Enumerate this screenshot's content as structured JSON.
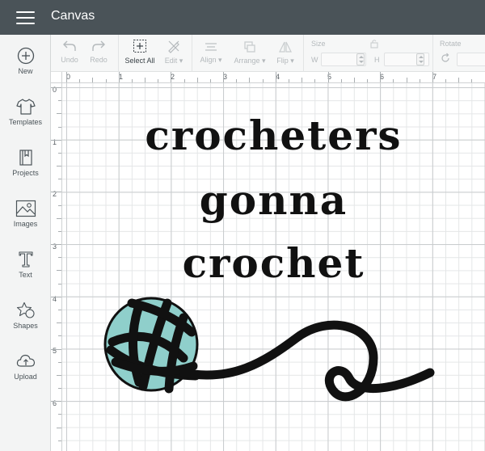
{
  "app": {
    "title": "Canvas"
  },
  "sidebar": {
    "items": [
      {
        "label": "New",
        "icon": "plus-circle-icon"
      },
      {
        "label": "Templates",
        "icon": "tshirt-icon"
      },
      {
        "label": "Projects",
        "icon": "book-icon"
      },
      {
        "label": "Images",
        "icon": "image-icon"
      },
      {
        "label": "Text",
        "icon": "text-t-icon"
      },
      {
        "label": "Shapes",
        "icon": "shapes-icon"
      },
      {
        "label": "Upload",
        "icon": "cloud-upload-icon"
      }
    ]
  },
  "toolbar": {
    "undo": "Undo",
    "redo": "Redo",
    "select_all": "Select All",
    "edit": "Edit",
    "align": "Align",
    "arrange": "Arrange",
    "flip": "Flip",
    "size": "Size",
    "w": "W",
    "h": "H",
    "rotate": "Rotate"
  },
  "ruler": {
    "top": [
      "0",
      "1",
      "2",
      "3",
      "4",
      "5",
      "6",
      "7"
    ],
    "left": [
      "0",
      "1",
      "2",
      "3",
      "4",
      "5",
      "6"
    ]
  },
  "design": {
    "lines": [
      "crocheters",
      "gonna",
      "crochet"
    ],
    "yarn_color": "#8fcfcb",
    "ink_color": "#111111"
  },
  "colors": {
    "titlebar": "#4a5358",
    "sidebar": "#f3f4f4",
    "toolbar": "#f6f7f7"
  }
}
